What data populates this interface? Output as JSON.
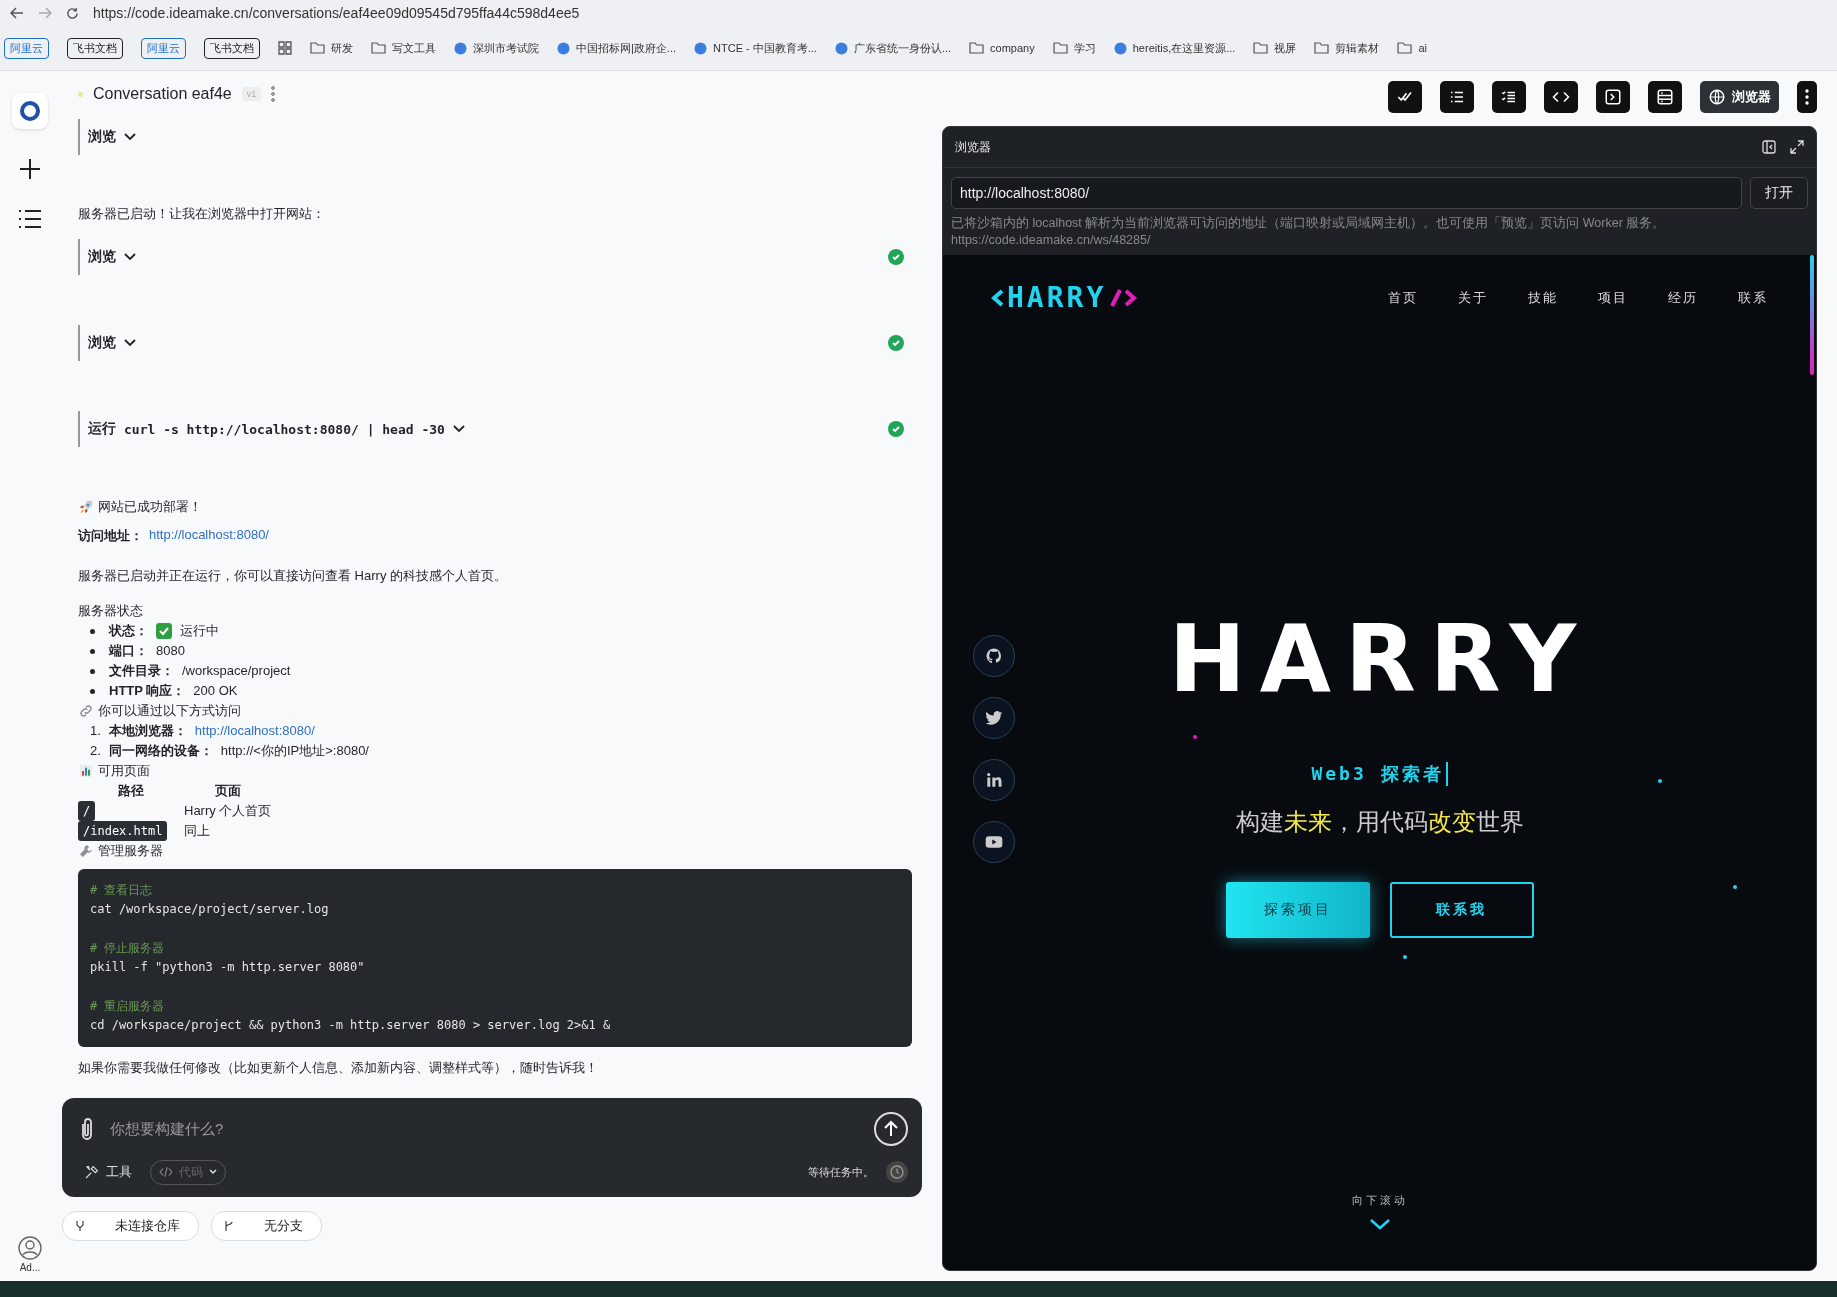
{
  "browser": {
    "url": "https://code.ideamake.cn/conversations/eaf4ee09d09545d795ffa44c598d4ee5",
    "bookmarks": [
      {
        "kind": "chip",
        "label": "阿里云",
        "color": "#1a6fd1"
      },
      {
        "kind": "chip",
        "label": "飞书文档",
        "color": "#222222"
      },
      {
        "kind": "chip",
        "label": "阿里云",
        "color": "#1a6fd1"
      },
      {
        "kind": "chip",
        "label": "飞书文档",
        "color": "#222222"
      },
      {
        "kind": "apps"
      },
      {
        "kind": "folder",
        "label": "研发"
      },
      {
        "kind": "folder",
        "label": "写文工具"
      },
      {
        "kind": "site",
        "label": "深圳市考试院"
      },
      {
        "kind": "site",
        "label": "中国招标网|政府企..."
      },
      {
        "kind": "site",
        "label": "NTCE - 中国教育考..."
      },
      {
        "kind": "site",
        "label": "广东省统一身份认..."
      },
      {
        "kind": "folder",
        "label": "company"
      },
      {
        "kind": "folder",
        "label": "学习"
      },
      {
        "kind": "site",
        "label": "hereitis,在这里资源..."
      },
      {
        "kind": "folder",
        "label": "视屏"
      },
      {
        "kind": "folder",
        "label": "剪辑素材"
      },
      {
        "kind": "folder",
        "label": "ai"
      }
    ]
  },
  "sidebar": {
    "user": "Ad..."
  },
  "conversation": {
    "title": "Conversation eaf4e",
    "version": "v1"
  },
  "messages": [
    {
      "kind": "tool",
      "label": "浏览",
      "done": false
    },
    {
      "kind": "text",
      "text": "服务器已启动！让我在浏览器中打开网站："
    },
    {
      "kind": "tool",
      "label": "浏览",
      "done": true
    },
    {
      "kind": "tool",
      "label": "浏览",
      "done": true
    },
    {
      "kind": "tool",
      "label": "运行",
      "command": "curl -s http://localhost:8080/ | head -30",
      "done": true
    },
    {
      "kind": "heading",
      "text": "网站已成功部署！"
    },
    {
      "kind": "link",
      "label": "访问地址：",
      "url": "http://localhost:8080/"
    },
    {
      "kind": "text",
      "text": "服务器已启动并正在运行，你可以直接访问查看 Harry 的科技感个人首页。"
    },
    {
      "kind": "plain",
      "text": "服务器状态"
    },
    {
      "kind": "bullets",
      "items": [
        {
          "label": "状态：",
          "value": "运行中",
          "check": true
        },
        {
          "label": "端口：",
          "value": "8080",
          "check": false
        },
        {
          "label": "文件目录：",
          "value": "/workspace/project",
          "check": false
        },
        {
          "label": "HTTP 响应：",
          "value": "200 OK",
          "check": false
        }
      ]
    },
    {
      "kind": "heading",
      "text": "你可以通过以下方式访问"
    },
    {
      "kind": "numbered",
      "items": [
        {
          "number": "1.",
          "label": "本地浏览器：",
          "value": "http://localhost:8080/",
          "link": true
        },
        {
          "number": "2.",
          "label": "同一网络的设备：",
          "value": "http://<你的IP地址>:8080/",
          "link": false
        }
      ]
    },
    {
      "kind": "heading",
      "text": "可用页面"
    },
    {
      "kind": "table",
      "columns": [
        "路径",
        "页面"
      ],
      "rows": [
        [
          "/",
          "Harry 个人首页"
        ],
        [
          "/index.html",
          "同上"
        ]
      ]
    },
    {
      "kind": "heading",
      "text": "管理服务器"
    },
    {
      "kind": "code",
      "groups": [
        {
          "comment": "# 查看日志",
          "command": "cat /workspace/project/server.log"
        },
        {
          "comment": "# 停止服务器",
          "command": "pkill -f \"python3 -m http.server 8080\""
        },
        {
          "comment": "# 重启服务器",
          "command": "cd /workspace/project && python3 -m http.server 8080 > server.log 2>&1 &"
        }
      ]
    },
    {
      "kind": "text",
      "text": "如果你需要我做任何修改（比如更新个人信息、添加新内容、调整样式等），随时告诉我！"
    }
  ],
  "composer": {
    "placeholder": "你想要构建什么?",
    "tools": "工具",
    "mode": "代码",
    "status": "等待任务中。"
  },
  "footer": {
    "repo": "未连接仓库",
    "branch": "无分支"
  },
  "toolbar": [
    {
      "selected": false
    },
    {
      "selected": false
    },
    {
      "selected": false
    },
    {
      "selected": false
    },
    {
      "selected": false
    },
    {
      "selected": false
    },
    {
      "label": "浏览器",
      "selected": true
    }
  ],
  "browser_panel": {
    "title": "浏览器",
    "url": "http://localhost:8080/",
    "open": "打开",
    "note": "已将沙箱内的 localhost 解析为当前浏览器可访问的地址（端口映射或局域网主机）。也可使用「预览」页访问 Worker 服务。 https://code.ideamake.cn/ws/48285/"
  },
  "site": {
    "logo": "HARRY",
    "nav": [
      "首页",
      "关于",
      "技能",
      "项目",
      "经历",
      "联系"
    ],
    "title": "HARRY",
    "subtitle": "Web3 探索者",
    "tagline": [
      {
        "text": "构建",
        "highlight": false
      },
      {
        "text": "未来",
        "highlight": true
      },
      {
        "text": "，用代码",
        "highlight": false
      },
      {
        "text": "改变",
        "highlight": true
      },
      {
        "text": "世界",
        "highlight": false
      }
    ],
    "buttons": [
      {
        "label": "探索项目",
        "primary": true
      },
      {
        "label": "联系我",
        "primary": false
      }
    ],
    "scroll": "向下滚动"
  }
}
